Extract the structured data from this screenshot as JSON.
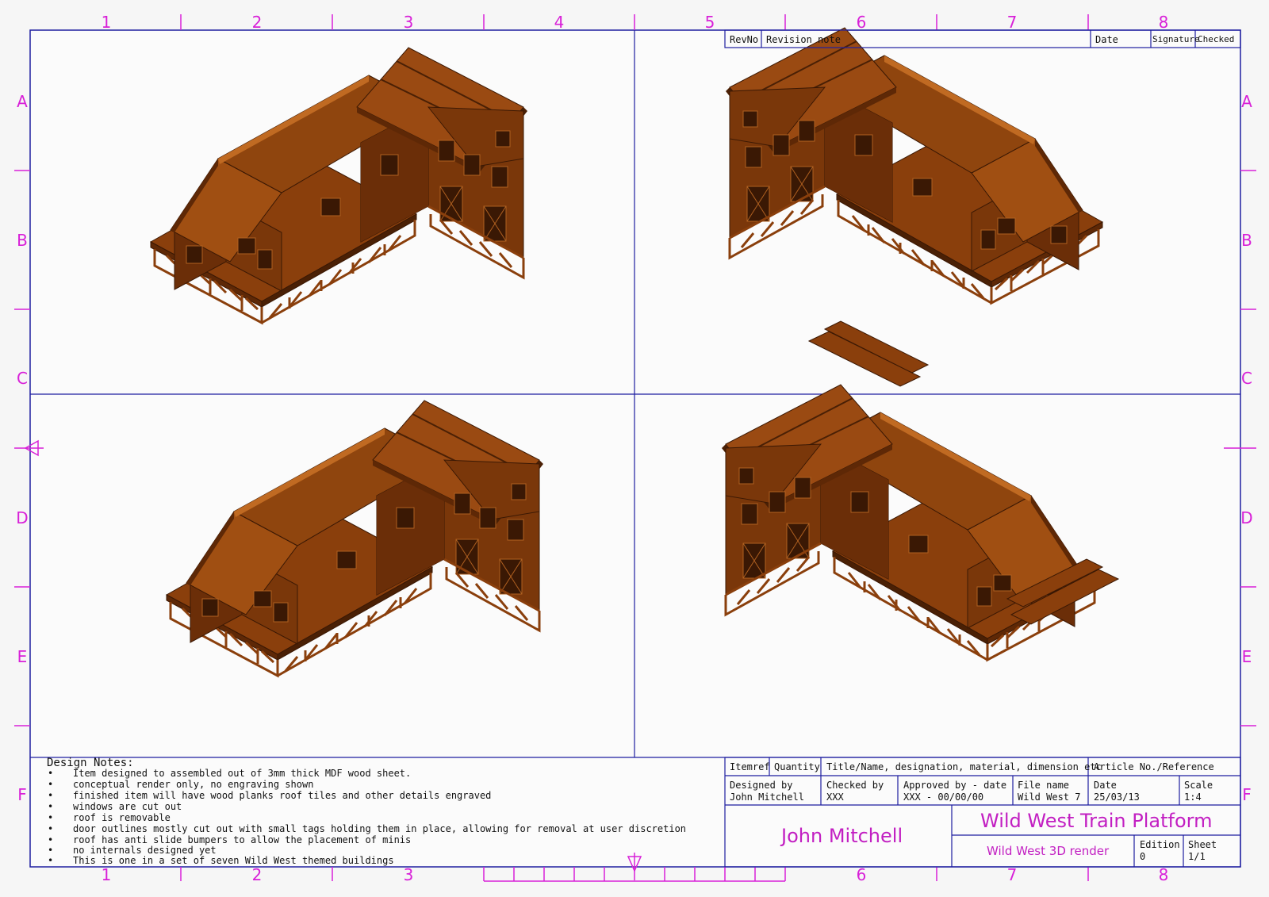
{
  "zones": {
    "columns": [
      "1",
      "2",
      "3",
      "4",
      "5",
      "6",
      "7",
      "8"
    ],
    "rows": [
      "A",
      "B",
      "C",
      "D",
      "E",
      "F"
    ]
  },
  "revision_block": {
    "headers": {
      "rev_no": "RevNo",
      "note": "Revision note",
      "date": "Date",
      "signature": "Signature",
      "checked": "Checked"
    }
  },
  "title_block": {
    "header": {
      "itemref": "Itemref",
      "quantity": "Quantity",
      "title": "Title/Name, designation, material, dimension etc",
      "article": "Article No./Reference"
    },
    "designed_by": {
      "label": "Designed by",
      "value": "John Mitchell"
    },
    "checked_by": {
      "label": "Checked by",
      "value": "XXX"
    },
    "approved_by": {
      "label": "Approved by - date",
      "value": "XXX - 00/00/00"
    },
    "file_name": {
      "label": "File name",
      "value": "Wild West 7"
    },
    "date": {
      "label": "Date",
      "value": "25/03/13"
    },
    "scale": {
      "label": "Scale",
      "value": "1:4"
    },
    "author_signature": "John Mitchell",
    "drawing_title": "Wild West Train Platform",
    "drawing_subtitle": "Wild West 3D render",
    "edition": {
      "label": "Edition",
      "value": "0"
    },
    "sheet": {
      "label": "Sheet",
      "value": "1/1"
    }
  },
  "design_notes": {
    "title": "Design Notes:",
    "items": [
      "Item designed to assembled out of 3mm thick MDF wood sheet.",
      "conceptual render only, no engraving shown",
      "finished item will have wood planks roof tiles and other details engraved",
      "windows are cut out",
      "roof is removable",
      "door outlines mostly cut out with small tags holding them in place, allowing for removal at user discretion",
      "roof has anti slide bumpers to allow the placement of minis",
      "no internals designed yet",
      "This is one in a set of seven Wild West themed buildings"
    ]
  },
  "colors": {
    "frame": "#1e1ea0",
    "zone_marks": "#d820d8",
    "model": "#8a3f0c",
    "model_light": "#a85818",
    "model_dark": "#5e2806"
  },
  "views": [
    "iso-view-front-left",
    "iso-view-back-right",
    "iso-view-back-left",
    "iso-view-front-right"
  ]
}
